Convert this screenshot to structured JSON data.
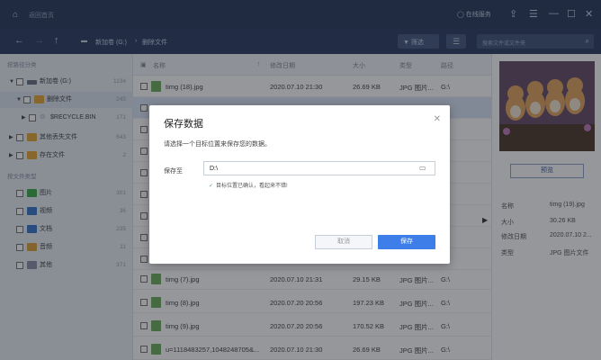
{
  "titlebar": {
    "app_name": "返回首页",
    "online_service": "在线服务"
  },
  "toolbar": {
    "drive_label": "新加卷 (G:)",
    "folder_label": "删除文件",
    "filter_label": "筛选",
    "search_placeholder": "搜索文件或文件夹"
  },
  "sidebar": {
    "location_title": "按路径分类",
    "type_title": "按文件类型",
    "tree": [
      {
        "label": "新加卷 (G:)",
        "count": "1134"
      },
      {
        "label": "删除文件",
        "count": "245"
      },
      {
        "label": "$RECYCLE.BIN",
        "count": "171"
      },
      {
        "label": "其他丢失文件",
        "count": "643"
      },
      {
        "label": "存在文件",
        "count": "2"
      }
    ],
    "types": [
      {
        "label": "图片",
        "count": "301",
        "color": "#3fae49"
      },
      {
        "label": "视频",
        "count": "36",
        "color": "#3a77c9"
      },
      {
        "label": "文档",
        "count": "235",
        "color": "#3a77c9"
      },
      {
        "label": "音频",
        "count": "11",
        "color": "#e0a23a"
      },
      {
        "label": "其他",
        "count": "371",
        "color": "#8a93a6"
      }
    ]
  },
  "list": {
    "headers": {
      "name": "名称",
      "date": "修改日期",
      "size": "大小",
      "type": "类型",
      "path": "路径"
    },
    "rows": [
      {
        "name": "timg (18).jpg",
        "date": "2020.07.10 21:30",
        "size": "26.69 KB",
        "type": "JPG 图片...",
        "path": "G:\\"
      },
      {
        "name": "timg (7).jpg",
        "date": "2020.07.10 21:31",
        "size": "29.15 KB",
        "type": "JPG 图片...",
        "path": "G:\\"
      },
      {
        "name": "timg (8).jpg",
        "date": "2020.07.20 20:56",
        "size": "197.23 KB",
        "type": "JPG 图片...",
        "path": "G:\\"
      },
      {
        "name": "timg (9).jpg",
        "date": "2020.07.20 20:56",
        "size": "170.52 KB",
        "type": "JPG 图片...",
        "path": "G:\\"
      },
      {
        "name": "u=1118483257,1048248705&...",
        "date": "2020.07.10 21:30",
        "size": "26.69 KB",
        "type": "JPG 图片...",
        "path": "G:\\"
      }
    ]
  },
  "details": {
    "preview_label": "预览",
    "name_key": "名称",
    "name_val": "timg (19).jpg",
    "size_key": "大小",
    "size_val": "30.26 KB",
    "date_key": "修改日期",
    "date_val": "2020.07.10 2...",
    "type_key": "类型",
    "type_val": "JPG 图片文件"
  },
  "dialog": {
    "title": "保存数据",
    "description": "请选择一个目标位置来保存您的数据。",
    "save_to_label": "保存至",
    "path_value": "D:\\",
    "hint": "目标位置已确认，看起来不错!",
    "cancel_label": "取消",
    "save_label": "保存"
  }
}
